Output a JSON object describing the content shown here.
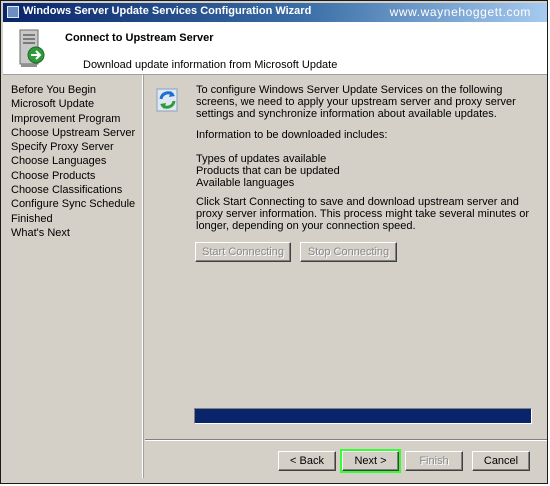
{
  "window": {
    "title": "Windows Server Update Services Configuration Wizard",
    "watermark": "www.waynehoggett.com"
  },
  "header": {
    "title": "Connect to Upstream Server",
    "subtitle": "Download update information from Microsoft Update"
  },
  "sidebar": {
    "items": [
      {
        "label": "Before You Begin"
      },
      {
        "label": "Microsoft Update Improvement Program"
      },
      {
        "label": "Choose Upstream Server"
      },
      {
        "label": "Specify Proxy Server"
      },
      {
        "label": "Choose Languages"
      },
      {
        "label": "Choose Products"
      },
      {
        "label": "Choose Classifications"
      },
      {
        "label": "Configure Sync Schedule"
      },
      {
        "label": "Finished"
      },
      {
        "label": "What's Next"
      }
    ]
  },
  "content": {
    "intro": "To configure Windows Server Update Services on the following screens, we need to apply your upstream server and proxy server settings and synchronize information about available updates.",
    "info_heading": "Information to be downloaded includes:",
    "info_items": [
      "Types of updates available",
      "Products that can be updated",
      "Available languages"
    ],
    "instruction": "Click Start Connecting to save and download upstream server and proxy server information. This process might take several minutes or longer, depending on your connection speed.",
    "start_button": "Start Connecting",
    "stop_button": "Stop Connecting",
    "progress_fraction": 1.0
  },
  "footer": {
    "back_button": "< Back",
    "next_button": "Next >",
    "finish_button": "Finish",
    "cancel_button": "Cancel"
  },
  "colors": {
    "progress_fill": "#0a246a",
    "highlight": "#33ff33",
    "title_bar": "#0a246a"
  },
  "icons": {
    "title": "wizard-window-icon",
    "header": "server-update-icon",
    "content": "sync-arrows-icon"
  }
}
